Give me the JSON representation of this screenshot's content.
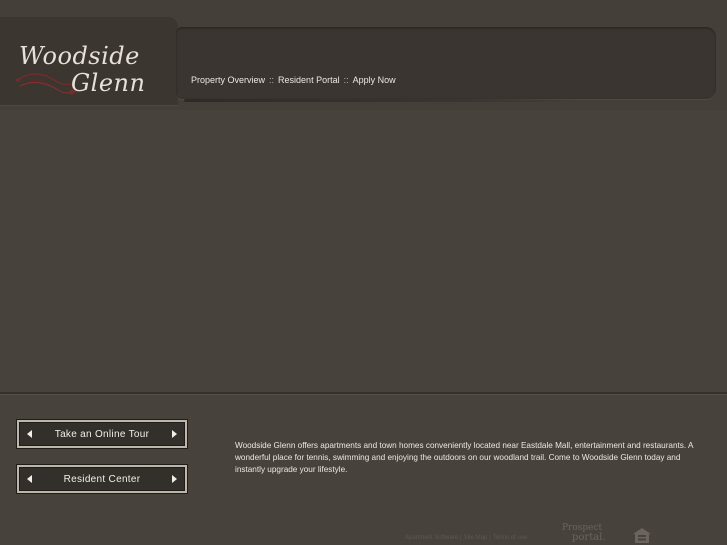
{
  "brand": {
    "logo_line1": "Woodside",
    "logo_line2": "Glenn"
  },
  "nav": {
    "items": [
      {
        "label": "Property Overview"
      },
      {
        "label": "Resident Portal"
      },
      {
        "label": "Apply Now"
      }
    ],
    "separator": "::"
  },
  "buttons": {
    "tour_label": "Take an Online Tour",
    "resident_label": "Resident Center"
  },
  "description": "Woodside Glenn offers apartments and town homes conveniently located near Eastdale Mall, entertainment and restaurants. A wonderful place for tennis, swimming and enjoying the outdoors on our woodland trail. Come to Woodside Glenn today and instantly upgrade your lifestyle.",
  "footer": {
    "links": [
      {
        "label": "Apartment Software"
      },
      {
        "label": "Site Map"
      },
      {
        "label": "Terms of use"
      }
    ],
    "separator": "|",
    "provider_line1": "Prospect",
    "provider_line2": "portal."
  },
  "colors": {
    "background": "#48423c",
    "panel": "#3a3530",
    "text": "#ece7df",
    "button_border": "#bdb6aa",
    "logo_accent": "#7a2a2a"
  }
}
